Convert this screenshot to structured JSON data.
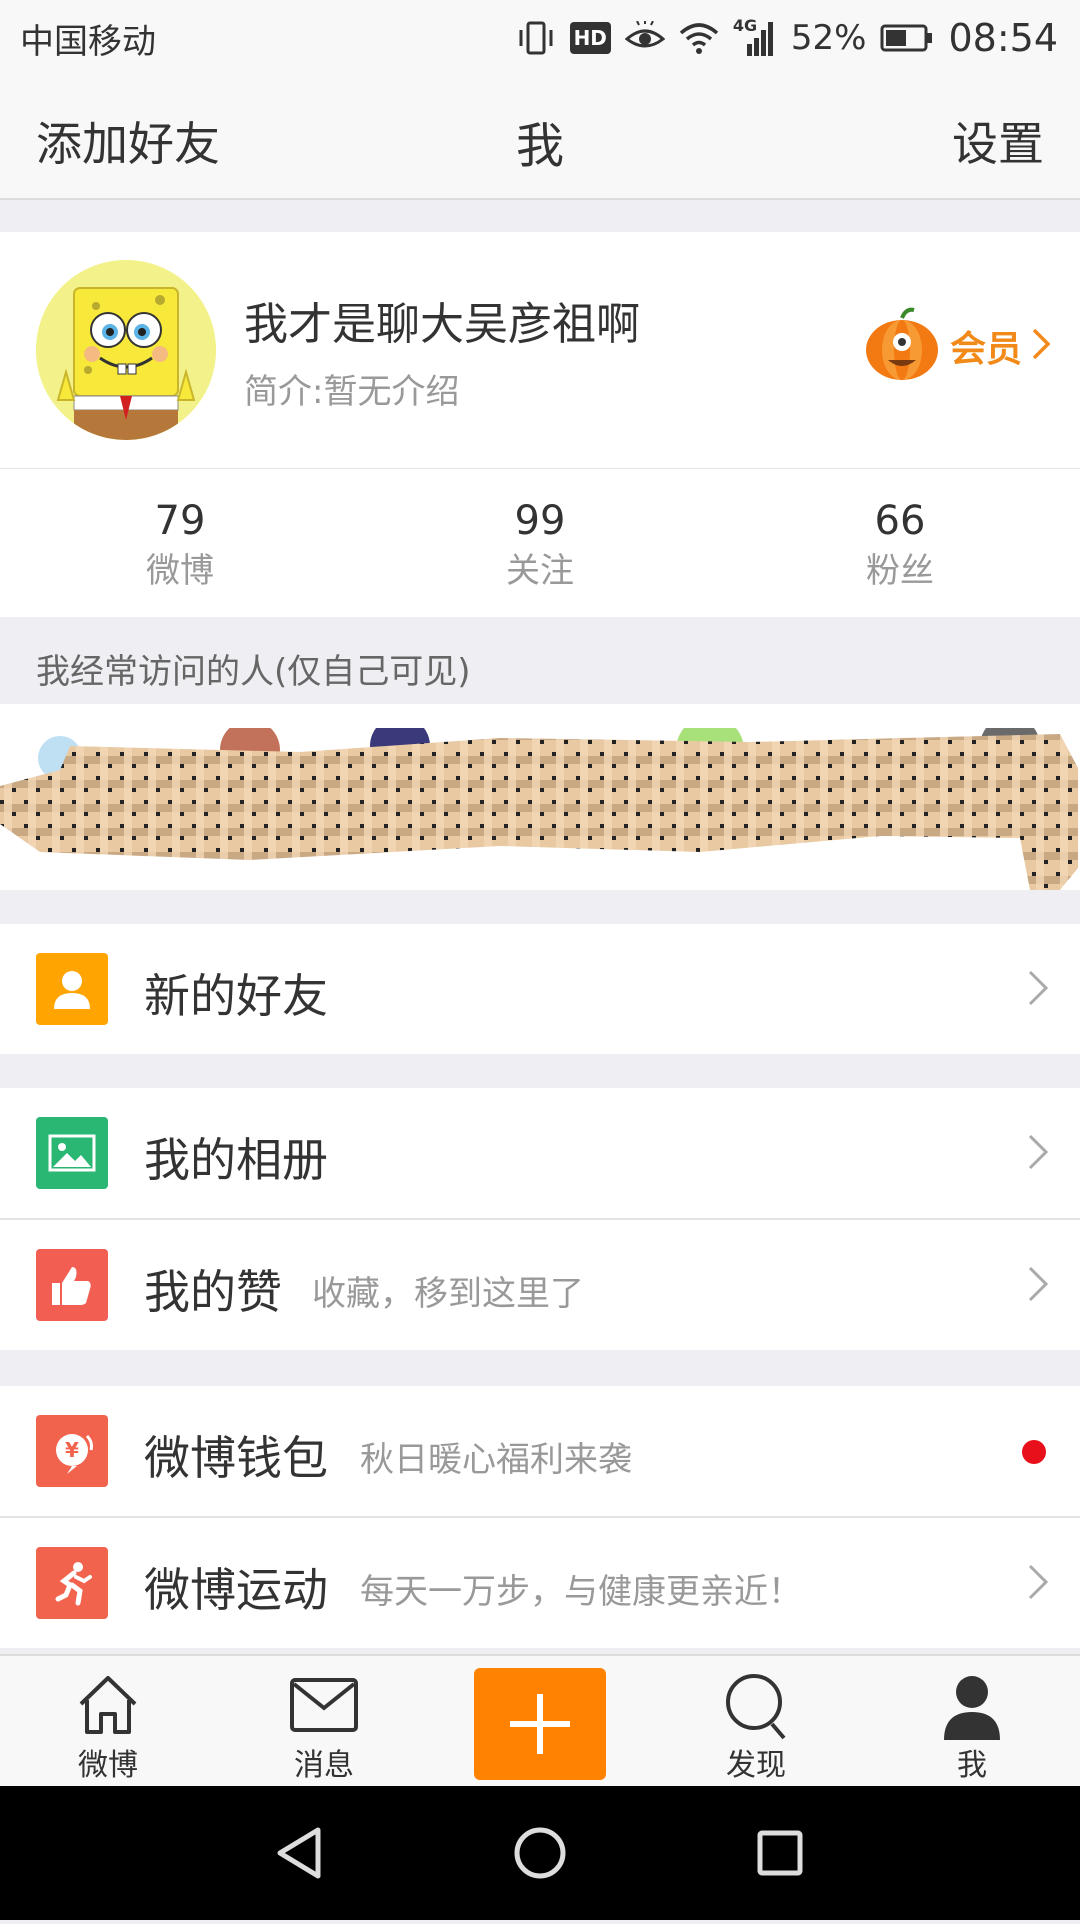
{
  "status_bar": {
    "carrier": "中国移动",
    "hd_label": "HD",
    "network": "4G",
    "battery": "52%",
    "time": "08:54"
  },
  "nav": {
    "left": "添加好友",
    "title": "我",
    "right": "设置"
  },
  "profile": {
    "name": "我才是聊大吴彦祖啊",
    "bio": "简介:暂无介绍",
    "vip_label": "会员"
  },
  "stats": [
    {
      "value": "79",
      "label": "微博"
    },
    {
      "value": "99",
      "label": "关注"
    },
    {
      "value": "66",
      "label": "粉丝"
    }
  ],
  "frequent": {
    "label": "我经常访问的人(仅自己可见)"
  },
  "rows": {
    "new_friends": {
      "title": "新的好友",
      "icon": "person-icon"
    },
    "album": {
      "title": "我的相册",
      "icon": "image-icon"
    },
    "likes": {
      "title": "我的赞",
      "subtitle": "收藏，移到这里了",
      "icon": "thumbs-up-icon"
    },
    "wallet": {
      "title": "微博钱包",
      "subtitle": "秋日暖心福利来袭",
      "icon": "wallet-icon"
    },
    "sport": {
      "title": "微博运动",
      "subtitle": "每天一万步，与健康更亲近！",
      "icon": "runner-icon"
    }
  },
  "tabs": [
    {
      "label": "微博",
      "icon": "home-icon"
    },
    {
      "label": "消息",
      "icon": "mail-icon"
    },
    {
      "label": "发现",
      "icon": "search-icon"
    },
    {
      "label": "我",
      "icon": "user-icon"
    }
  ],
  "colors": {
    "accent": "#ff8200",
    "vip": "#f28a1a",
    "new_friends_icon": "#ffa400",
    "album_icon": "#2ab673",
    "likes_icon": "#f25e52",
    "wallet_icon": "#f2634d",
    "sport_icon": "#f2634d",
    "red_dot": "#e8101a"
  }
}
